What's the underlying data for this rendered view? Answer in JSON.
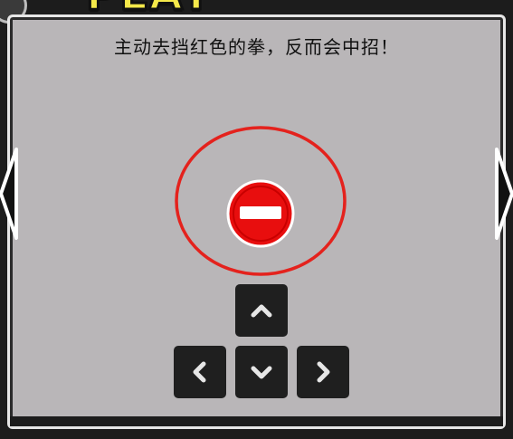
{
  "title": "HOW TO PLAY",
  "instruction": "主动去挡红色的拳，反而会中招！",
  "hint_icon": "no-entry-block-icon",
  "controls": {
    "keys": [
      "up",
      "left",
      "down",
      "right"
    ]
  },
  "colors": {
    "panel": "#b9b6b8",
    "frame": "#1c1c1c",
    "title": "#f5e94a",
    "ring": "#e4221d",
    "block_icon": "#e80e0e",
    "key": "#1f1f1f",
    "key_glyph": "#e6e6e6"
  }
}
